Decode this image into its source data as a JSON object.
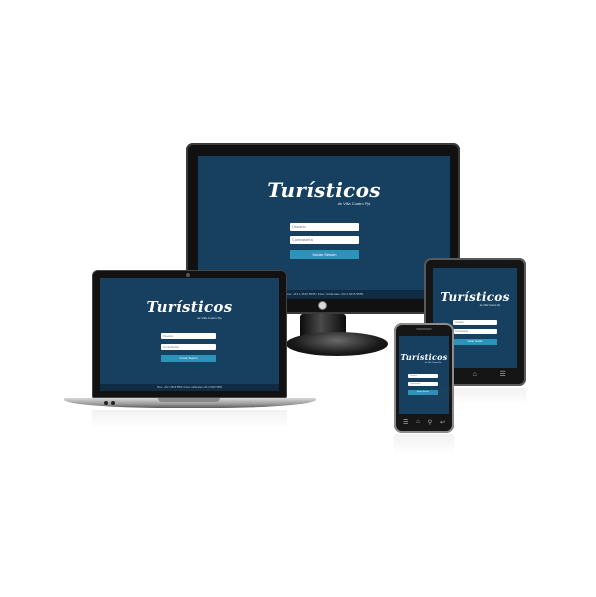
{
  "brand": {
    "logo_text": "Turísticos",
    "logo_sub": "de Villa Cuatro Pjs"
  },
  "login": {
    "user_placeholder": "Usuario",
    "password_placeholder": "Contraseña",
    "submit_label": "Iniciar Sesión"
  },
  "footer": {
    "text": "Hine: +54 1 3515 5555 / Fixer: Adriandes +54 3 5415 5555"
  },
  "icons": {
    "back": "back-icon",
    "home": "home-icon",
    "menu": "menu-icon",
    "search": "search-icon"
  },
  "colors": {
    "screen_bg": "#173f5f",
    "button": "#2c93b9",
    "footer_bg": "#0f2c44"
  }
}
